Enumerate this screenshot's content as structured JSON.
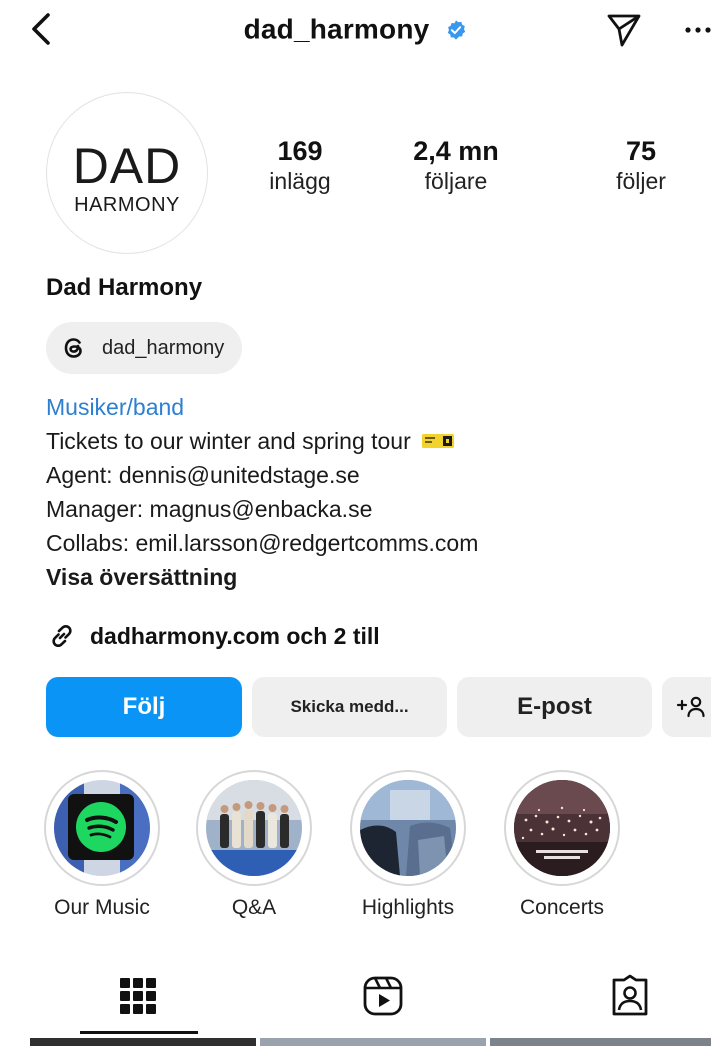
{
  "header": {
    "username": "dad_harmony",
    "verified": true,
    "accent": "#3897f0"
  },
  "avatar": {
    "logo_top": "DAD",
    "logo_bottom": "HARMONY"
  },
  "stats": [
    {
      "value": "169",
      "label": "inlägg"
    },
    {
      "value": "2,4 mn",
      "label": "följare"
    },
    {
      "value": "75",
      "label": "följer"
    }
  ],
  "profile": {
    "name": "Dad Harmony",
    "threads_handle": "dad_harmony"
  },
  "bio": {
    "category": "Musiker/band",
    "line1": "Tickets to our winter and spring tour",
    "line2": "Agent: dennis@unitedstage.se",
    "line3": "Manager: magnus@enbacka.se",
    "line4": "Collabs: emil.larsson@redgertcomms.com",
    "translate": "Visa översättning"
  },
  "links": {
    "label": "dadharmony.com och 2 till"
  },
  "actions": {
    "follow": "Följ",
    "message": "Skicka medd...",
    "email": "E-post"
  },
  "highlights": [
    {
      "label": "Our Music",
      "icon": "spotify-icon"
    },
    {
      "label": "Q&A",
      "icon": "band-photo"
    },
    {
      "label": "Highlights",
      "icon": "stage-photo"
    },
    {
      "label": "Concerts",
      "icon": "crowd-photo"
    }
  ],
  "tabs": [
    {
      "name": "grid",
      "icon": "grid-icon",
      "active": true
    },
    {
      "name": "reels",
      "icon": "reels-icon",
      "active": false
    },
    {
      "name": "tagged",
      "icon": "tagged-icon",
      "active": false
    }
  ],
  "colors": {
    "follow_button": "#0a95f6",
    "secondary_button": "#efefef",
    "link_blue": "#2d7fd0"
  }
}
